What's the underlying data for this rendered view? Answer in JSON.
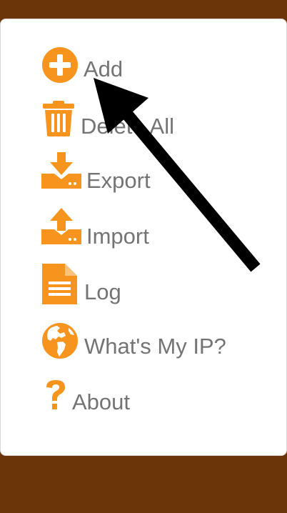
{
  "menu": {
    "items": [
      {
        "label": "Add",
        "icon": "plus-circle-icon"
      },
      {
        "label": "Delete All",
        "icon": "trash-icon"
      },
      {
        "label": "Export",
        "icon": "download-tray-icon"
      },
      {
        "label": "Import",
        "icon": "upload-tray-icon"
      },
      {
        "label": "Log",
        "icon": "document-icon"
      },
      {
        "label": "What's My IP?",
        "icon": "globe-icon"
      },
      {
        "label": "About",
        "icon": "question-mark-icon"
      }
    ]
  },
  "colors": {
    "accent": "#f7941d",
    "label": "#747474",
    "background": "#6b3409",
    "panel": "#ffffff",
    "annotation_arrow": "#000000"
  }
}
